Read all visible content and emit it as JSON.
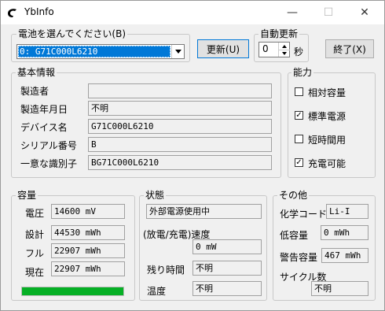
{
  "window": {
    "title": "YbInfo",
    "minimize": "—",
    "maximize": "☐",
    "close": "✕"
  },
  "battery_select": {
    "label": "電池を選んでください(B)",
    "value": "0: G71C000L6210"
  },
  "buttons": {
    "refresh": "更新(U)",
    "exit": "終了(X)"
  },
  "auto_refresh": {
    "label": "自動更新",
    "value": "0",
    "unit": "秒"
  },
  "basic": {
    "title": "基本情報",
    "rows": [
      {
        "label": "製造者",
        "value": ""
      },
      {
        "label": "製造年月日",
        "value": "不明"
      },
      {
        "label": "デバイス名",
        "value": "G71C000L6210"
      },
      {
        "label": "シリアル番号",
        "value": "B"
      },
      {
        "label": "一意な識別子",
        "value": "BG71C000L6210"
      }
    ]
  },
  "capability": {
    "title": "能力",
    "items": [
      {
        "label": "相対容量",
        "checked": false,
        "mark": ""
      },
      {
        "label": "標準電源",
        "checked": true,
        "mark": "✓"
      },
      {
        "label": "短時間用",
        "checked": false,
        "mark": ""
      },
      {
        "label": "充電可能",
        "checked": true,
        "mark": "✓"
      }
    ]
  },
  "capacity": {
    "title": "容量",
    "rows": [
      {
        "label": "電圧",
        "value": "14600 mV"
      },
      {
        "label": "設計",
        "value": "44530 mWh"
      },
      {
        "label": "フル",
        "value": "22907 mWh"
      },
      {
        "label": "現在",
        "value": "22907 mWh"
      }
    ],
    "charge_percent": 100,
    "bar_color": "#06b025"
  },
  "status": {
    "title": "状態",
    "power_source": "外部電源使用中",
    "rate_label": "(放電/充電)速度",
    "rate_value": "0 mW",
    "remaining_label": "残り時間",
    "remaining_value": "不明",
    "temp_label": "温度",
    "temp_value": "不明"
  },
  "other": {
    "title": "その他",
    "chemistry_label": "化学コード",
    "chemistry_value": "Li-I",
    "low_cap_label": "低容量",
    "low_cap_value": "0 mWh",
    "warn_cap_label": "警告容量",
    "warn_cap_value": "467 mWh",
    "cycle_label": "サイクル数",
    "cycle_value": "不明"
  }
}
